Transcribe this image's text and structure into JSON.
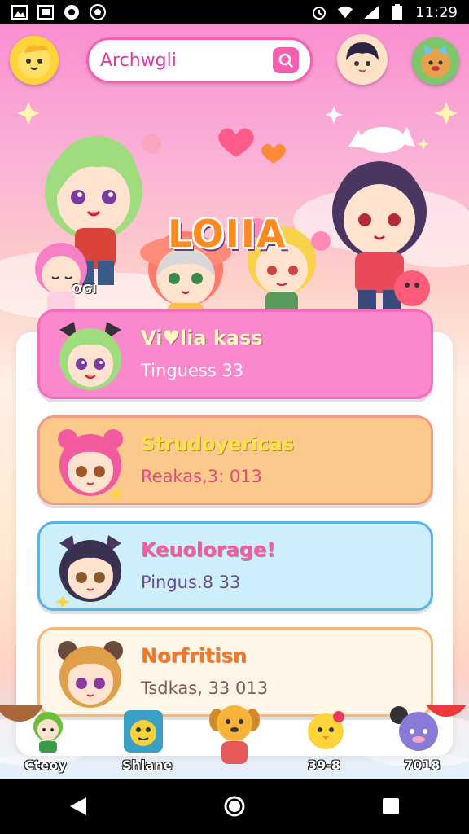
{
  "status_bar": {
    "time": "11:29",
    "left_icons": [
      "gallery-icon",
      "picture-icon",
      "sync-icon",
      "camera-icon"
    ],
    "right_icons": [
      "alarm-icon",
      "wifi-icon",
      "signal-icon",
      "battery-icon"
    ]
  },
  "header": {
    "search_text": "Archwgli",
    "search_button_icon": "heart-search-icon"
  },
  "hero": {
    "title": "LOIIA",
    "tag": "OGI"
  },
  "list": [
    {
      "title": "Vi♥lia kass",
      "subtitle": "Tinguess 33",
      "accent": "#f56bbd",
      "bg": "#fb88cc",
      "title_color": "#fff6c0",
      "sub_color": "#ffffff"
    },
    {
      "title": "Strudoyericas",
      "subtitle": "Reakas,3: 013",
      "accent": "#f59a82",
      "bg": "#fcc98d",
      "title_color": "#ffe24a",
      "sub_color": "#e24a7a"
    },
    {
      "title": "Keuolorage!",
      "subtitle": "Pingus.8 33",
      "accent": "#58b4e8",
      "bg": "#cdeefb",
      "title_color": "#f45c9e",
      "sub_color": "#6a4a8a"
    },
    {
      "title": "Norfritisn",
      "subtitle": "Tsdkas, 33 013",
      "accent": "#f6b878",
      "bg": "#fff6e8",
      "title_color": "#f07a28",
      "sub_color": "#7a5a5a"
    }
  ],
  "dock": [
    {
      "label": "Cteoy"
    },
    {
      "label": "Shlane"
    },
    {
      "label": ""
    },
    {
      "label": "39-8"
    },
    {
      "label": "7018"
    }
  ],
  "nav": {
    "back_icon": "back-icon",
    "home_icon": "home-icon",
    "recents_icon": "recents-icon"
  }
}
